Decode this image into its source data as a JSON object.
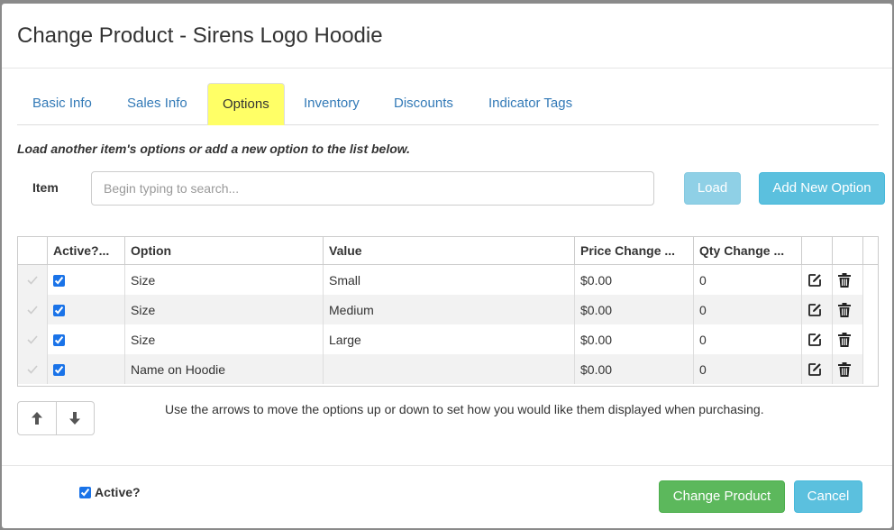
{
  "modal": {
    "title": "Change Product - Sirens Logo Hoodie"
  },
  "tabs": [
    {
      "label": "Basic Info",
      "active": false
    },
    {
      "label": "Sales Info",
      "active": false
    },
    {
      "label": "Options",
      "active": true
    },
    {
      "label": "Inventory",
      "active": false
    },
    {
      "label": "Discounts",
      "active": false
    },
    {
      "label": "Indicator Tags",
      "active": false
    }
  ],
  "instructions": "Load another item's options or add a new option to the list below.",
  "item_search": {
    "label": "Item",
    "placeholder": "Begin typing to search...",
    "value": ""
  },
  "buttons": {
    "load": "Load",
    "add_new_option": "Add New Option",
    "change_product": "Change Product",
    "cancel": "Cancel"
  },
  "grid": {
    "columns": [
      "",
      "Active?...",
      "Option",
      "Value",
      "Price Change ...",
      "Qty Change ...",
      "",
      ""
    ],
    "rows": [
      {
        "active": true,
        "option": "Size",
        "value": "Small",
        "price_change": "$0.00",
        "qty_change": "0"
      },
      {
        "active": true,
        "option": "Size",
        "value": "Medium",
        "price_change": "$0.00",
        "qty_change": "0"
      },
      {
        "active": true,
        "option": "Size",
        "value": "Large",
        "price_change": "$0.00",
        "qty_change": "0"
      },
      {
        "active": true,
        "option": "Name on Hoodie",
        "value": "",
        "price_change": "$0.00",
        "qty_change": "0"
      }
    ],
    "row_icons": {
      "select": "checkmark-icon",
      "edit": "edit-icon",
      "delete": "trash-icon"
    }
  },
  "arrows": {
    "up_icon": "arrow-up-icon",
    "down_icon": "arrow-down-icon"
  },
  "hint": "Use the arrows to move the options up or down to set how you would like them displayed when purchasing.",
  "footer": {
    "active_label": "Active?",
    "active_checked": true
  },
  "colors": {
    "tab_highlight": "#ffff66",
    "link": "#337ab7",
    "info": "#5bc0de",
    "success": "#5cb85c"
  }
}
